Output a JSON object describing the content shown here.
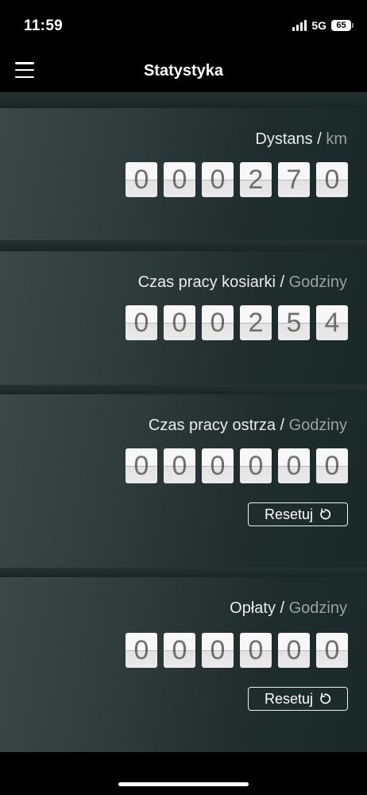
{
  "status_bar": {
    "time": "11:59",
    "network": "5G",
    "battery": "65"
  },
  "nav": {
    "title": "Statystyka",
    "menu_icon": "hamburger-menu-icon"
  },
  "panels": [
    {
      "label": "Dystans",
      "separator": " / ",
      "unit": "km",
      "digits": [
        "0",
        "0",
        "0",
        "2",
        "7",
        "0"
      ]
    },
    {
      "label": "Czas pracy kosiarki",
      "separator": " / ",
      "unit": "Godziny",
      "digits": [
        "0",
        "0",
        "0",
        "2",
        "5",
        "4"
      ]
    },
    {
      "label": "Czas pracy ostrza",
      "separator": " / ",
      "unit": "Godziny",
      "digits": [
        "0",
        "0",
        "0",
        "0",
        "0",
        "0"
      ],
      "reset_label": "Resetuj"
    },
    {
      "label": "Opłaty",
      "separator": " / ",
      "unit": "Godziny",
      "digits": [
        "0",
        "0",
        "0",
        "0",
        "0",
        "0"
      ],
      "reset_label": "Resetuj"
    }
  ],
  "icons": {
    "reset": "reset-icon",
    "signal": "signal-icon",
    "battery": "battery-icon"
  },
  "colors": {
    "background": "#000000",
    "panel": "#2d3a39",
    "digit_tile": "#f7f7f7",
    "digit_text": "#6f6f6f",
    "unit_text": "#9aa2a1"
  }
}
